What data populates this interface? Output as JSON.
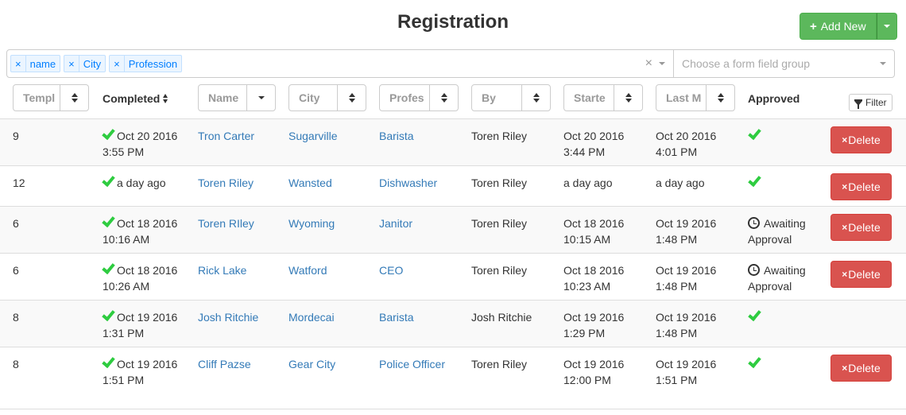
{
  "page": {
    "title": "Registration",
    "add_button_label": "Add New"
  },
  "filter_bar": {
    "tags": [
      "name",
      "City",
      "Profession"
    ],
    "tag_remove_symbol": "×",
    "clear_symbol": "×",
    "group_placeholder": "Choose a form field group"
  },
  "headers": {
    "template": "Templ",
    "completed": "Completed",
    "name": "Name",
    "city": "City",
    "profession": "Profes",
    "by": "By",
    "started": "Starte",
    "last_modified": "Last M",
    "approved": "Approved",
    "filter_label": "Filter"
  },
  "rows": [
    {
      "template": "9",
      "completed": "Oct 20 2016",
      "completed_time": "3:55 PM",
      "name": "Tron Carter",
      "city": "Sugarville",
      "profession": "Barista",
      "by": "Toren Riley",
      "started": "Oct 20 2016",
      "started_time": "3:44 PM",
      "last": "Oct 20 2016",
      "last_time": "4:01 PM",
      "approved": true,
      "status_line1": "",
      "status_line2": "",
      "has_delete": true
    },
    {
      "template": "12",
      "completed": "a day ago",
      "completed_time": "",
      "name": "Toren Riley",
      "city": "Wansted",
      "profession": "Dishwasher",
      "by": "Toren Riley",
      "started": "a day ago",
      "started_time": "",
      "last": "a day ago",
      "last_time": "",
      "approved": true,
      "status_line1": "",
      "status_line2": "",
      "has_delete": true
    },
    {
      "template": "6",
      "completed": "Oct 18 2016",
      "completed_time": "10:16 AM",
      "name": "Toren RIley",
      "city": "Wyoming",
      "profession": "Janitor",
      "by": "Toren Riley",
      "started": "Oct 18 2016",
      "started_time": "10:15 AM",
      "last": "Oct 19 2016",
      "last_time": "1:48 PM",
      "approved": false,
      "status_line1": "Awaiting",
      "status_line2": "Approval",
      "has_delete": true
    },
    {
      "template": "6",
      "completed": "Oct 18 2016",
      "completed_time": "10:26 AM",
      "name": "Rick Lake",
      "city": "Watford",
      "profession": "CEO",
      "by": "Toren Riley",
      "started": "Oct 18 2016",
      "started_time": "10:23 AM",
      "last": "Oct 19 2016",
      "last_time": "1:48 PM",
      "approved": false,
      "status_line1": "Awaiting",
      "status_line2": "Approval",
      "has_delete": true
    },
    {
      "template": "8",
      "completed": "Oct 19 2016",
      "completed_time": "1:31 PM",
      "name": "Josh Ritchie",
      "city": "Mordecai",
      "profession": "Barista",
      "by": "Josh Ritchie",
      "started": "Oct 19 2016",
      "started_time": "1:29 PM",
      "last": "Oct 19 2016",
      "last_time": "1:48 PM",
      "approved": true,
      "status_line1": "",
      "status_line2": "",
      "has_delete": false
    },
    {
      "template": "8",
      "completed": "Oct 19 2016",
      "completed_time": "1:51 PM",
      "name": "Cliff Pazse",
      "city": "Gear City",
      "profession": "Police Officer",
      "by": "Toren Riley",
      "started": "Oct 19 2016",
      "started_time": "12:00 PM",
      "last": "Oct 19 2016",
      "last_time": "1:51 PM",
      "approved": true,
      "status_line1": "",
      "status_line2": "",
      "has_delete": true
    }
  ],
  "delete_label": "Delete",
  "delete_symbol": "×",
  "colors": {
    "success": "#5cb85c",
    "danger": "#d9534f",
    "link": "#337ab7",
    "check": "#2ecc40",
    "tag_bg": "#ebf5ff",
    "tag_text": "#007eff"
  }
}
